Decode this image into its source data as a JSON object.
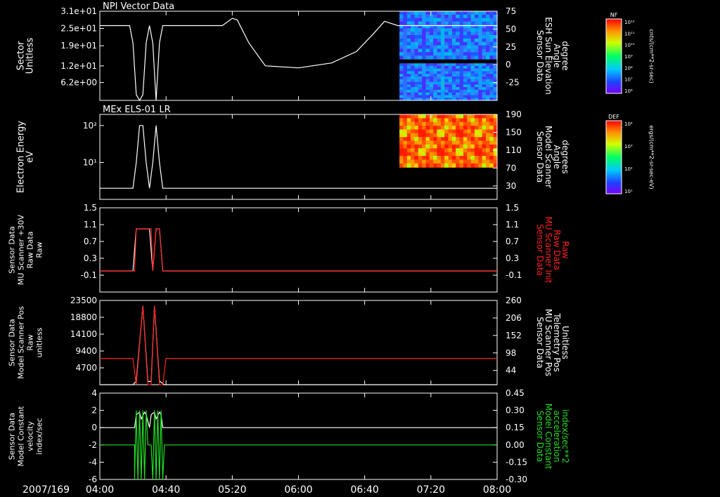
{
  "colors": {
    "background": "#000000",
    "axis": "#ffffff",
    "trace_white": "#ffffff",
    "trace_red": "#ff2020",
    "trace_green": "#22dd22"
  },
  "footer": {
    "date_label": "2007/169"
  },
  "colorbars": [
    {
      "title": "NF",
      "ticks": [
        "10¹²",
        "10¹¹",
        "10¹⁰",
        "10⁹",
        "10⁸",
        "10⁷",
        "10⁶"
      ],
      "unit": "cnts/(cm**2-sr-sec)"
    },
    {
      "title": "DEF",
      "ticks": [
        "10⁴",
        "10³",
        "10²",
        "10¹"
      ],
      "unit": "ergs/(cm**2-sr-sec-eV)"
    }
  ],
  "chart_data": [
    {
      "type": "line",
      "title": "NPI Vector Data",
      "x_ticks": [
        "04:00",
        "04:40",
        "05:20",
        "06:00",
        "06:40",
        "07:20",
        "08:00"
      ],
      "left_axis": {
        "label": [
          "Sector",
          "Unitless"
        ],
        "ticks": [
          "3.1e+01",
          "2.5e+01",
          "1.9e+01",
          "1.2e+01",
          "6.2e+00"
        ],
        "ylim": [
          0,
          31
        ]
      },
      "right_axis": {
        "label": [
          "Sensor Data",
          "ESH Sun Elevation",
          "Angle",
          "degree"
        ],
        "ticks": [
          "75",
          "50",
          "25",
          "0",
          "-25"
        ],
        "ylim": [
          -50,
          75
        ]
      },
      "series": [
        {
          "axis": "left",
          "color": "white",
          "x": [
            "04:00",
            "04:18",
            "04:20",
            "04:22",
            "04:24",
            "04:26",
            "04:28",
            "04:30",
            "04:32",
            "04:34",
            "04:36",
            "04:38",
            "05:14",
            "05:20",
            "05:23",
            "05:30",
            "05:40",
            "06:00",
            "06:20",
            "06:35",
            "06:45",
            "06:52",
            "07:00",
            "08:00"
          ],
          "values": [
            26,
            26,
            20,
            2,
            0,
            2,
            20,
            26,
            20,
            0,
            20,
            26,
            26,
            28.5,
            28,
            20,
            12,
            11.3,
            13,
            17,
            23,
            27.5,
            26,
            26
          ]
        }
      ],
      "spectrogram": {
        "x_range": [
          "07:01",
          "08:00"
        ],
        "y_range": [
          -50,
          75
        ],
        "gap": [
          2,
          8
        ]
      }
    },
    {
      "type": "line",
      "title": "MEx ELS-01 LR",
      "x_ticks": [
        "04:00",
        "04:40",
        "05:20",
        "06:00",
        "06:40",
        "07:20",
        "08:00"
      ],
      "left_axis": {
        "label": [
          "Electron Energy",
          "eV"
        ],
        "ticks": [
          "10²",
          "10¹"
        ],
        "scale": "log",
        "ylim": [
          1,
          200
        ]
      },
      "right_axis": {
        "label": [
          "Sensor Data",
          "Model Scanner",
          "Angle",
          "degrees"
        ],
        "ticks": [
          "190",
          "150",
          "110",
          "70",
          "30"
        ],
        "ylim": [
          0,
          190
        ]
      },
      "series": [
        {
          "axis": "left",
          "color": "white",
          "x": [
            "04:00",
            "04:20",
            "04:22",
            "04:24",
            "04:26",
            "04:28",
            "04:30",
            "04:32",
            "04:34",
            "04:36",
            "04:38",
            "08:00"
          ],
          "values": [
            2,
            2,
            10,
            100,
            100,
            10,
            2,
            10,
            100,
            10,
            2,
            2
          ]
        }
      ],
      "spectrogram": {
        "x_range": [
          "07:01",
          "08:00"
        ],
        "y_range": [
          72,
          190
        ]
      }
    },
    {
      "type": "line",
      "x_ticks": [
        "04:00",
        "04:40",
        "05:20",
        "06:00",
        "06:40",
        "07:20",
        "08:00"
      ],
      "left_axis": {
        "label": [
          "Sensor Data",
          "MU Scanner +30V",
          "Raw Data",
          "Raw"
        ],
        "ticks": [
          "1.5",
          "1.1",
          "0.7",
          "0.3",
          "-0.1"
        ],
        "ylim": [
          -0.5,
          1.5
        ]
      },
      "right_axis": {
        "label": [
          "Sensor Data",
          "MU Scanner Init",
          "Raw Data",
          "Raw"
        ],
        "ticks": [
          "1.5",
          "1.1",
          "0.7",
          "0.3",
          "-0.1"
        ],
        "ylim": [
          -0.5,
          1.5
        ],
        "color": "red"
      },
      "series": [
        {
          "axis": "left",
          "color": "white",
          "x": [
            "04:00",
            "04:20",
            "04:22",
            "04:30",
            "04:32",
            "04:34",
            "04:36",
            "04:38",
            "04:40",
            "08:00"
          ],
          "values": [
            0,
            0,
            1,
            1,
            0,
            1,
            1,
            0,
            0,
            0
          ]
        },
        {
          "axis": "right",
          "color": "red",
          "x": [
            "04:00",
            "04:21",
            "04:22",
            "04:31",
            "04:32",
            "04:34",
            "04:36",
            "04:38",
            "04:39",
            "08:00"
          ],
          "values": [
            0,
            0,
            1,
            1,
            0,
            1,
            1,
            0,
            0,
            0
          ]
        }
      ]
    },
    {
      "type": "line",
      "x_ticks": [
        "04:00",
        "04:40",
        "05:20",
        "06:00",
        "06:40",
        "07:20",
        "08:00"
      ],
      "left_axis": {
        "label": [
          "Sensor Data",
          "Model Scanner Pos",
          "Raw",
          "unitless"
        ],
        "ticks": [
          "23500",
          "18800",
          "14100",
          "9400",
          "4700"
        ],
        "ylim": [
          0,
          23500
        ]
      },
      "right_axis": {
        "label": [
          "Sensor Data",
          "MU Scanner Pos",
          "Telemetry Pos",
          "Unitless"
        ],
        "ticks": [
          "260",
          "206",
          "152",
          "98",
          "44"
        ],
        "ylim": [
          0,
          260
        ]
      },
      "series": [
        {
          "axis": "left",
          "color": "white",
          "x": [
            "04:00",
            "04:20",
            "04:22",
            "04:26",
            "04:29",
            "04:31",
            "04:33",
            "04:36",
            "04:39",
            "08:00"
          ],
          "values": [
            0,
            0,
            1000,
            22000,
            900,
            900,
            22000,
            1000,
            0,
            0
          ]
        },
        {
          "axis": "right",
          "color": "red",
          "x": [
            "04:00",
            "04:20",
            "04:22",
            "04:26",
            "04:29",
            "04:31",
            "04:33",
            "04:36",
            "04:38",
            "04:40",
            "08:00"
          ],
          "values": [
            81,
            81,
            0,
            243,
            0,
            0,
            243,
            0,
            0,
            81,
            81
          ]
        }
      ]
    },
    {
      "type": "line",
      "x_ticks": [
        "04:00",
        "04:40",
        "05:20",
        "06:00",
        "06:40",
        "07:20",
        "08:00"
      ],
      "left_axis": {
        "label": [
          "Sensor Data",
          "Model Constant",
          "velocity",
          "index/sec"
        ],
        "ticks": [
          "4",
          "2",
          "0",
          "-2",
          "-4",
          "-6"
        ],
        "ylim": [
          -6,
          4
        ]
      },
      "right_axis": {
        "label": [
          "Sensor Data",
          "Model Constant",
          "acceleration",
          "index/sec**2"
        ],
        "ticks": [
          "0.45",
          "0.30",
          "0.15",
          "0.00",
          "-0.15",
          "-0.30"
        ],
        "ylim": [
          -0.3,
          0.45
        ],
        "color": "green"
      },
      "series": [
        {
          "axis": "left",
          "color": "white",
          "x": [
            "04:00",
            "04:21",
            "04:22",
            "04:24",
            "04:25",
            "04:27",
            "04:28",
            "04:30",
            "04:31",
            "04:33",
            "04:34",
            "04:36",
            "04:37",
            "04:38",
            "08:00"
          ],
          "values": [
            0,
            0,
            1.5,
            1.8,
            1.0,
            1.8,
            1.5,
            0,
            1.5,
            1.8,
            1.0,
            1.8,
            1.5,
            0,
            0
          ]
        },
        {
          "axis": "right",
          "color": "green",
          "x": [
            "04:00",
            "04:21",
            "04:21",
            "04:22",
            "04:23",
            "04:24",
            "04:25",
            "04:26",
            "04:27",
            "04:28",
            "04:29",
            "04:31",
            "04:32",
            "04:33",
            "04:34",
            "04:35",
            "04:36",
            "04:37",
            "04:38",
            "04:39",
            "08:00"
          ],
          "values": [
            0,
            0,
            -0.3,
            0.3,
            -0.3,
            0.3,
            -0.3,
            0.3,
            -0.3,
            0.3,
            0,
            0,
            -0.3,
            0.3,
            -0.3,
            0.3,
            -0.3,
            0.3,
            -0.3,
            0,
            0
          ]
        }
      ]
    }
  ]
}
